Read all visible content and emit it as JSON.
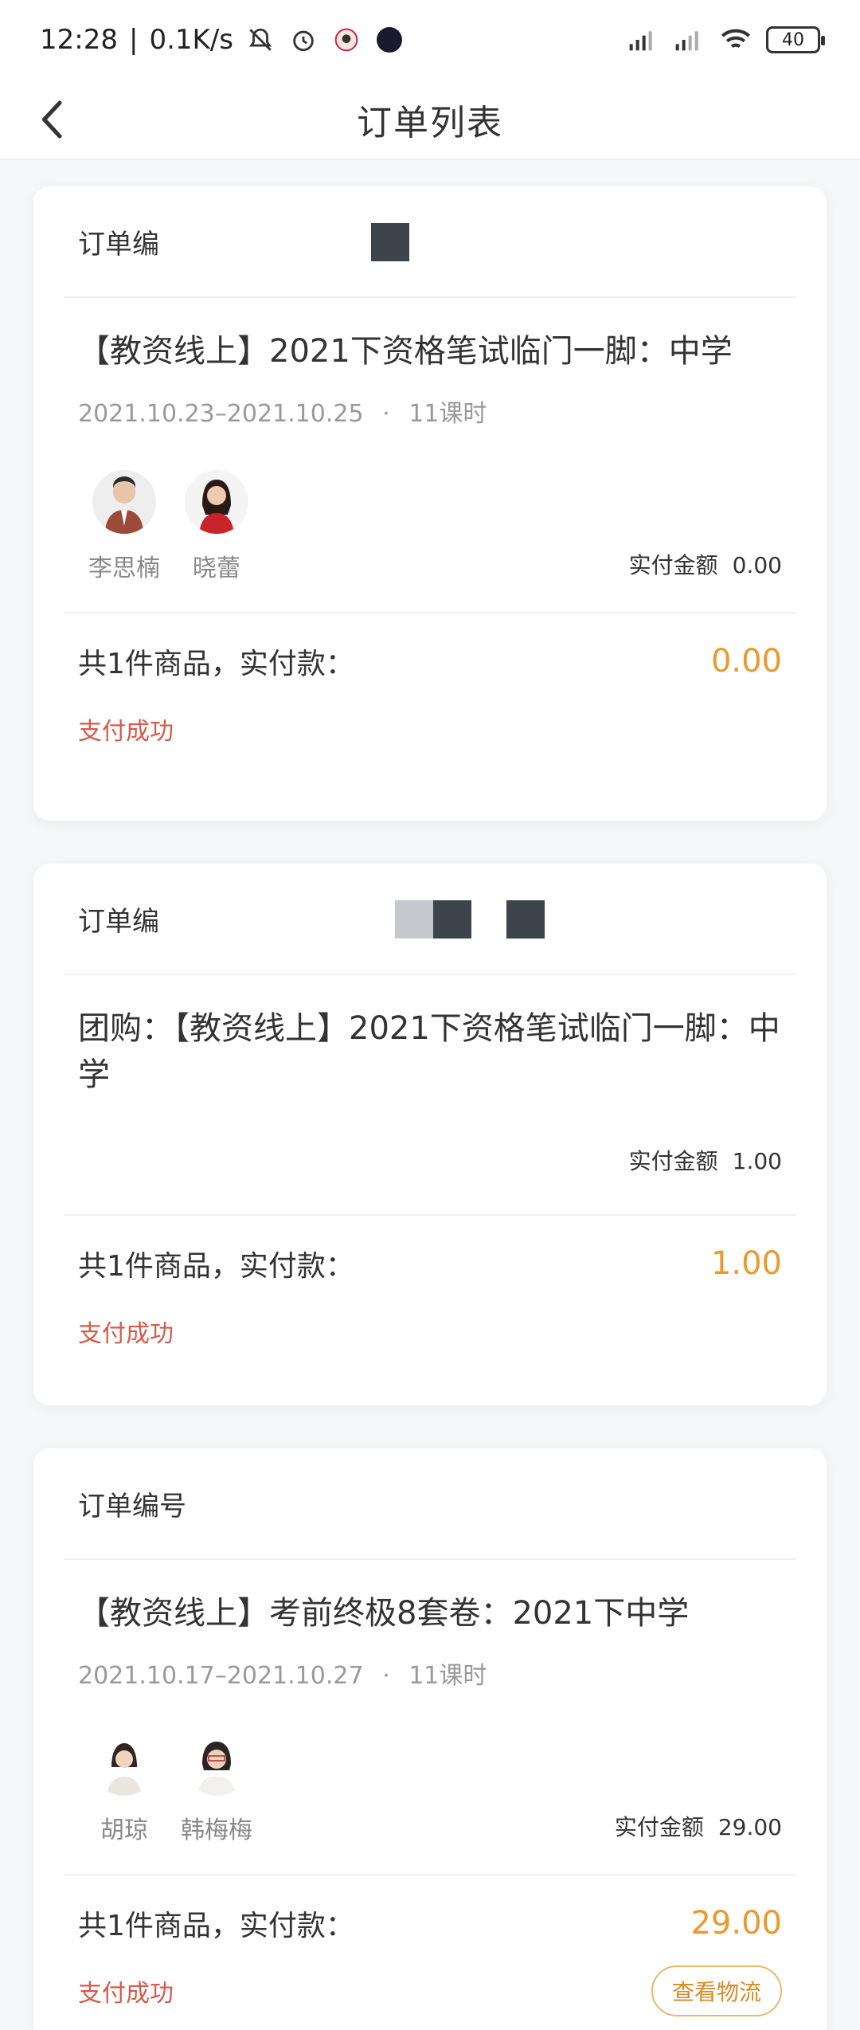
{
  "status_bar": {
    "time": "12:28",
    "net_speed": "0.1K/s",
    "battery": "40",
    "icons": [
      "bell-off-icon",
      "alarm-icon",
      "app-icon",
      "tiktok-icon",
      "signal-hd-icon",
      "signal-hd-icon",
      "wifi-icon",
      "battery-icon"
    ]
  },
  "nav": {
    "title": "订单列表",
    "back_icon": "chevron-left-icon"
  },
  "orders": [
    {
      "order_label": "订单编",
      "title": "【教资线上】2021下资格笔试临门一脚：中学",
      "date_range": "2021.10.23–2021.10.25",
      "dot": "·",
      "lessons": "11课时",
      "teachers": [
        "李思楠",
        "晓蕾"
      ],
      "paid_label": "实付金额",
      "paid_value": "0.00",
      "summary_label": "共1件商品，实付款：",
      "total": "0.00",
      "status": "支付成功"
    },
    {
      "order_label": "订单编",
      "title": "团购：【教资线上】2021下资格笔试临门一脚：中学",
      "paid_label": "实付金额",
      "paid_value": "1.00",
      "summary_label": "共1件商品，实付款：",
      "total": "1.00",
      "status": "支付成功"
    },
    {
      "order_label": "订单编号",
      "title": "【教资线上】考前终极8套卷：2021下中学",
      "date_range": "2021.10.17–2021.10.27",
      "dot": "·",
      "lessons": "11课时",
      "teachers": [
        "胡琼",
        "韩梅梅"
      ],
      "paid_label": "实付金额",
      "paid_value": "29.00",
      "summary_label": "共1件商品，实付款：",
      "total": "29.00",
      "status": "支付成功",
      "logistics_label": "查看物流"
    }
  ],
  "colors": {
    "accent_orange": "#e89a2e",
    "status_red": "#d75a4a",
    "background": "#f5f6f8"
  }
}
